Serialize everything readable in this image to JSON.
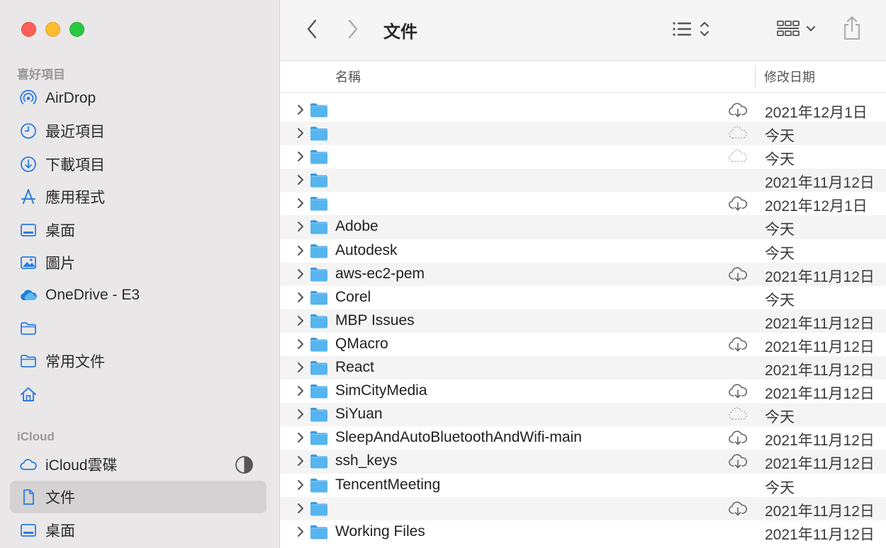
{
  "sidebar": {
    "favorites_title": "喜好項目",
    "favorites": [
      {
        "label": "AirDrop",
        "icon": "airdrop-icon"
      },
      {
        "label": "最近項目",
        "icon": "clock-icon"
      },
      {
        "label": "下載項目",
        "icon": "download-icon"
      },
      {
        "label": "應用程式",
        "icon": "applications-icon"
      },
      {
        "label": "桌面",
        "icon": "desktop-icon"
      },
      {
        "label": "圖片",
        "icon": "pictures-icon"
      },
      {
        "label": "OneDrive - E3",
        "icon": "onedrive-icon"
      },
      {
        "label": "",
        "icon": "folder-icon"
      },
      {
        "label": "常用文件",
        "icon": "folder-icon"
      },
      {
        "label": "",
        "icon": "home-icon"
      }
    ],
    "icloud_title": "iCloud",
    "icloud": [
      {
        "label": "iCloud雲碟",
        "icon": "icloud-icon"
      },
      {
        "label": "文件",
        "icon": "document-icon",
        "selected": true
      },
      {
        "label": "桌面",
        "icon": "desktop-icon"
      }
    ]
  },
  "toolbar": {
    "title": "文件",
    "back_icon": "chevron-left-icon",
    "forward_icon": "chevron-right-icon",
    "view_icon": "list-view-icon",
    "group_icon": "grid-group-icon",
    "share_icon": "share-icon"
  },
  "columns": {
    "name": "名稱",
    "date": "修改日期"
  },
  "colors": {
    "accent": "#2a7be4",
    "folder": "#4fb0ec",
    "sidebar_bg": "#e9e7e7"
  },
  "files": [
    {
      "name": "",
      "cloud": "download",
      "date": "2021年12月1日"
    },
    {
      "name": "",
      "cloud": "dotted",
      "date": "今天"
    },
    {
      "name": "",
      "cloud": "dotted",
      "date": "今天"
    },
    {
      "name": "",
      "cloud": "",
      "date": "2021年11月12日"
    },
    {
      "name": "",
      "cloud": "download",
      "date": "2021年12月1日"
    },
    {
      "name": "Adobe",
      "cloud": "",
      "date": "今天"
    },
    {
      "name": "Autodesk",
      "cloud": "",
      "date": "今天"
    },
    {
      "name": "aws-ec2-pem",
      "cloud": "download",
      "date": "2021年11月12日"
    },
    {
      "name": "Corel",
      "cloud": "",
      "date": "今天"
    },
    {
      "name": "MBP Issues",
      "cloud": "",
      "date": "2021年11月12日"
    },
    {
      "name": "QMacro",
      "cloud": "download",
      "date": "2021年11月12日"
    },
    {
      "name": "React",
      "cloud": "",
      "date": "2021年11月12日"
    },
    {
      "name": "SimCityMedia",
      "cloud": "download",
      "date": "2021年11月12日"
    },
    {
      "name": "SiYuan",
      "cloud": "dotted",
      "date": "今天"
    },
    {
      "name": "SleepAndAutoBluetoothAndWifi-main",
      "cloud": "download",
      "date": "2021年11月12日"
    },
    {
      "name": "ssh_keys",
      "cloud": "download",
      "date": "2021年11月12日"
    },
    {
      "name": "TencentMeeting",
      "cloud": "",
      "date": "今天"
    },
    {
      "name": "",
      "cloud": "download",
      "date": "2021年11月12日"
    },
    {
      "name": "Working Files",
      "cloud": "",
      "date": "2021年11月12日"
    }
  ]
}
